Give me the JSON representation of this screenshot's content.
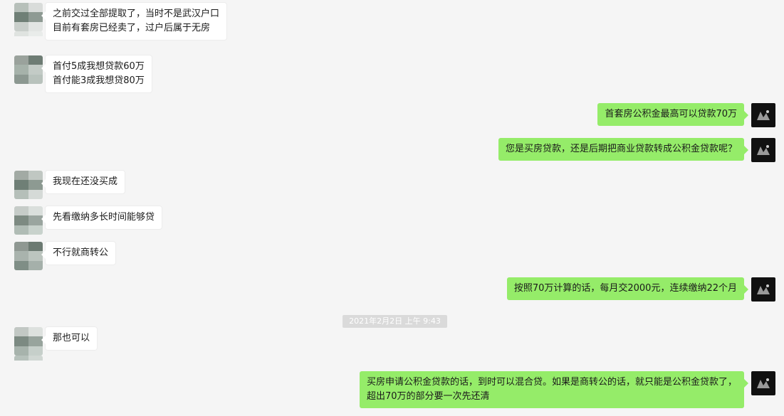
{
  "colors": {
    "background": "#f5f5f5",
    "received_bubble": "#ffffff",
    "sent_bubble": "#95ec69",
    "timestamp_bg": "#dadada"
  },
  "icons": {
    "contact_avatar": "pixelated-avatar-icon",
    "self_avatar": "dark-photo-avatar-icon"
  },
  "messages": [
    {
      "side": "left",
      "lines": [
        "之前交过全部提取了，当时不是武汉户口",
        "目前有套房已经卖了，过户后属于无房"
      ]
    },
    {
      "side": "left",
      "lines": [
        "首付5成我想贷款60万",
        "首付能3成我想贷80万"
      ]
    },
    {
      "side": "right",
      "lines": [
        "首套房公积金最高可以贷款70万"
      ]
    },
    {
      "side": "right",
      "lines": [
        "您是买房贷款，还是后期把商业贷款转成公积金贷款呢？"
      ]
    },
    {
      "side": "left",
      "lines": [
        "我现在还没买成"
      ]
    },
    {
      "side": "left",
      "lines": [
        "先看缴纳多长时间能够贷"
      ]
    },
    {
      "side": "left",
      "lines": [
        "不行就商转公"
      ]
    },
    {
      "side": "right",
      "lines": [
        "按照70万计算的话，每月交2000元，连续缴纳22个月"
      ]
    },
    {
      "side": "left",
      "lines": [
        "那也可以"
      ]
    },
    {
      "side": "right",
      "lines": [
        "买房申请公积金贷款的话，到时可以混合贷。如果是商转公的话，就只能是公积金贷款了，",
        "超出70万的部分要一次先还清"
      ]
    }
  ],
  "timestamp": "2021年2月2日 上午 9:43"
}
